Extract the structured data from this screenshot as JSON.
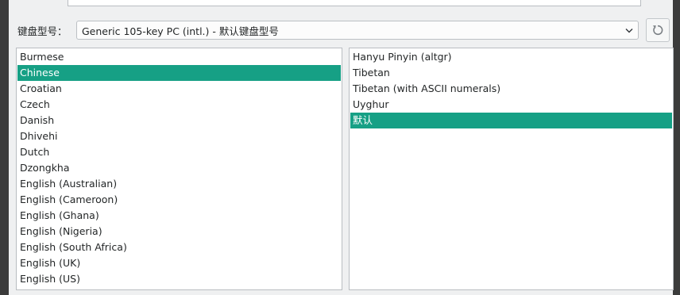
{
  "keyboard": {
    "model_label": "键盘型号：",
    "model_value": "Generic 105-key PC (intl.)  -  默认键盘型号",
    "reset_icon": "reset-icon"
  },
  "layouts": [
    "Burmese",
    "Chinese",
    "Croatian",
    "Czech",
    "Danish",
    "Dhivehi",
    "Dutch",
    "Dzongkha",
    "English (Australian)",
    "English (Cameroon)",
    "English (Ghana)",
    "English (Nigeria)",
    "English (South Africa)",
    "English (UK)",
    "English (US)"
  ],
  "selected_layout": "Chinese",
  "variants": [
    "Hanyu Pinyin (altgr)",
    "Tibetan",
    "Tibetan (with ASCII numerals)",
    "Uyghur",
    "默认"
  ],
  "selected_variant": "默认",
  "colors": {
    "selection": "#16a085",
    "panel": "#eff0f1",
    "background": "#4a4a4a"
  }
}
